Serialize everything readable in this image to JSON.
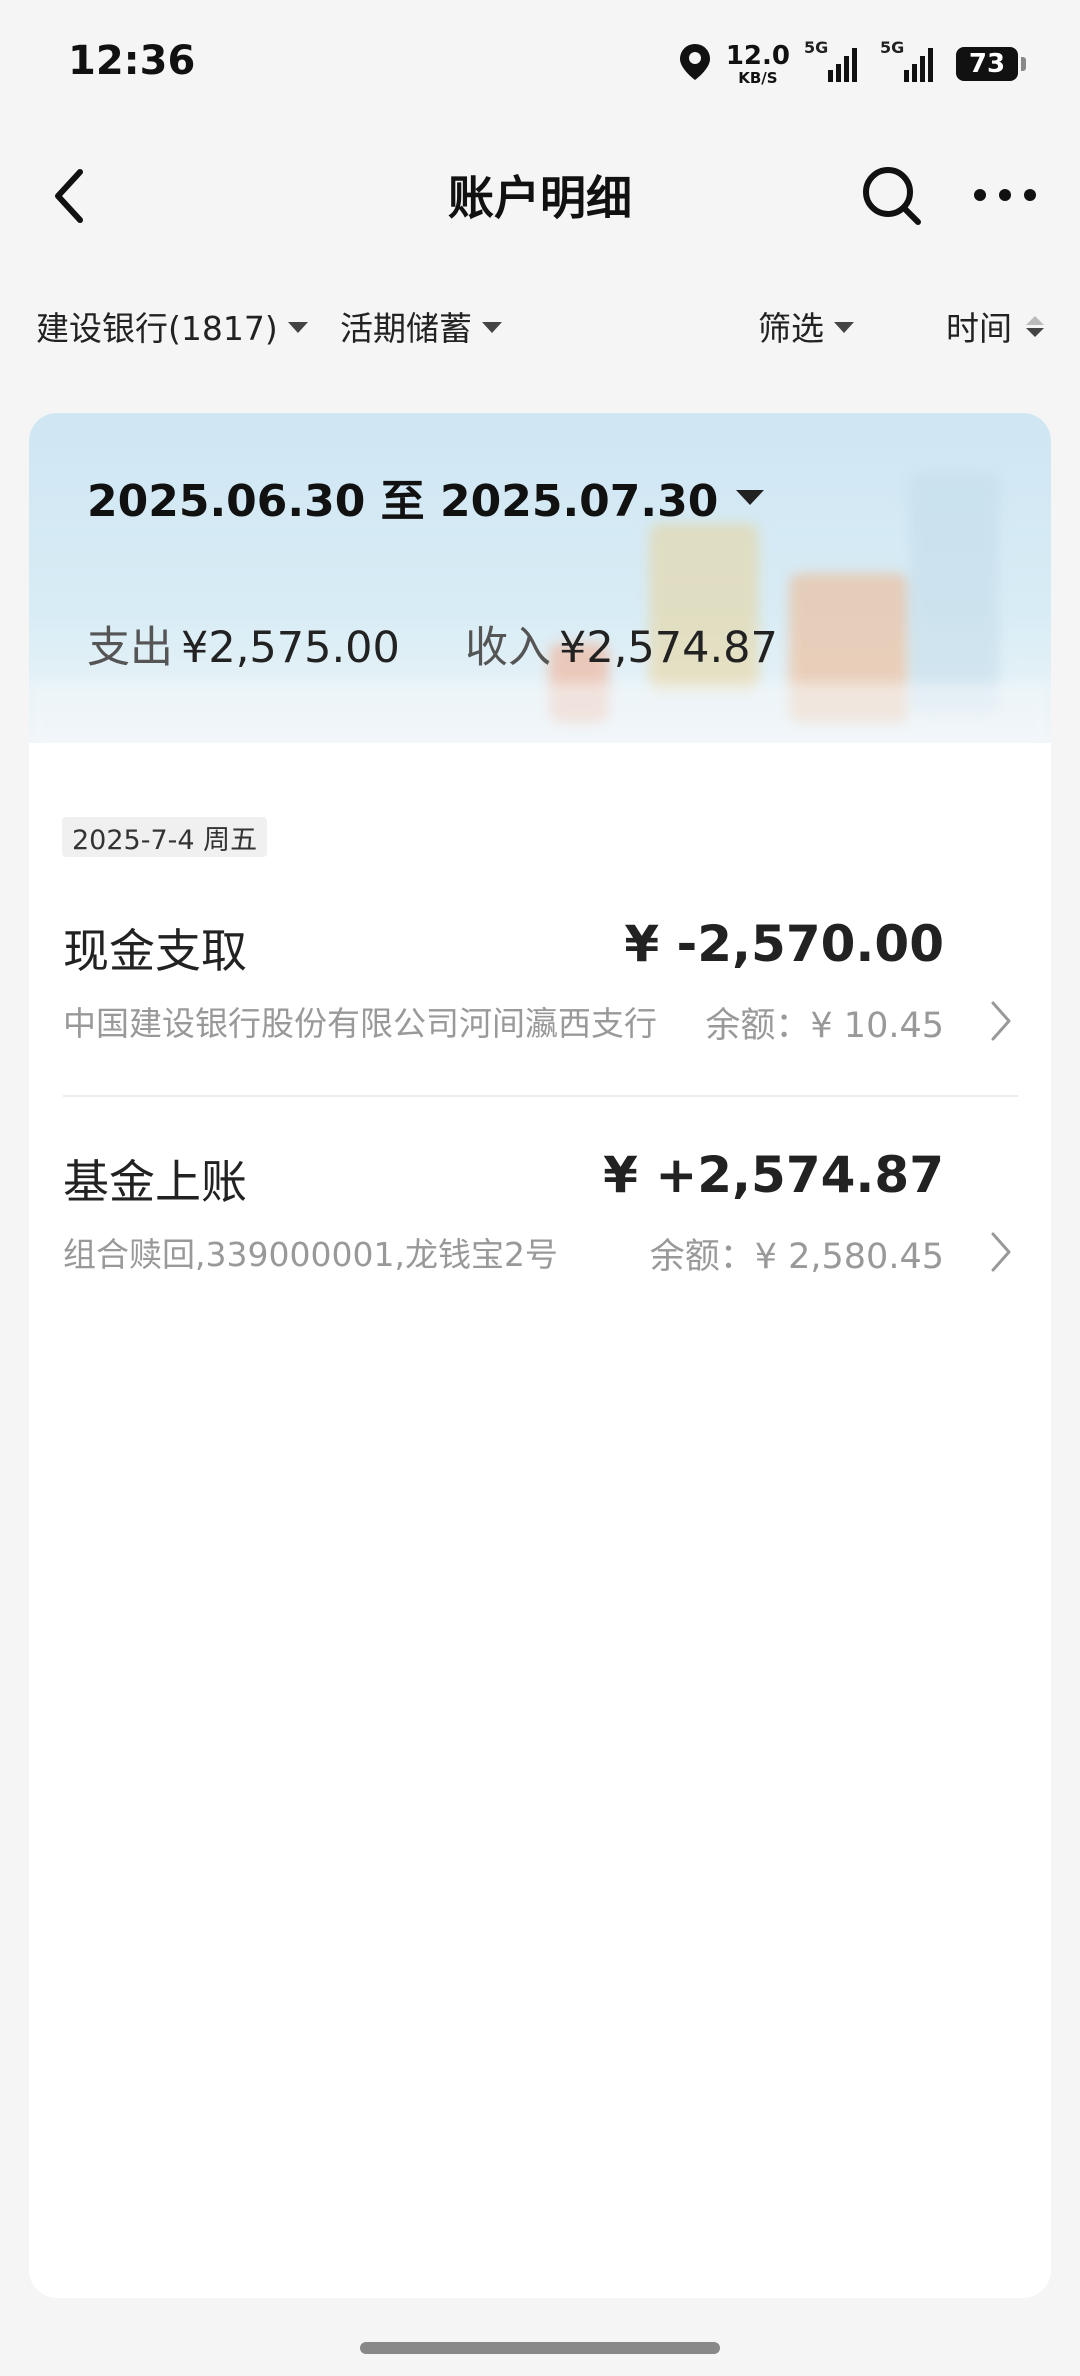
{
  "status_bar": {
    "time": "12:36",
    "net_speed_value": "12.0",
    "net_speed_unit": "KB/S",
    "signal1_label": "5G",
    "signal2_label": "5G",
    "battery": "73",
    "icons": [
      "location-icon",
      "signal-icon",
      "battery-icon"
    ]
  },
  "header": {
    "title": "账户明细",
    "icons": [
      "back-arrow-icon",
      "search-icon",
      "more-icon"
    ]
  },
  "filters": {
    "account": "建设银行(1817)",
    "account_type": "活期储蓄",
    "filter": "筛选",
    "time": "时间"
  },
  "summary": {
    "date_range": "2025.06.30 至 2025.07.30",
    "expense_label": "支出",
    "expense_value": "¥2,575.00",
    "income_label": "收入",
    "income_value": "¥2,574.87"
  },
  "date_group": "2025-7-4 周五",
  "transactions": [
    {
      "title": "现金支取",
      "amount": "¥ -2,570.00",
      "desc": "中国建设银行股份有限公司河间瀛西支行",
      "balance": "余额：¥ 10.45"
    },
    {
      "title": "基金上账",
      "amount": "¥ +2,574.87",
      "desc": "组合赎回,339000001,龙钱宝2号",
      "balance": "余额：¥ 2,580.45"
    }
  ],
  "colors": {
    "background": "#f5f5f5",
    "card": "#ffffff",
    "banner": "#d3e8f3",
    "muted_text": "#999999"
  }
}
